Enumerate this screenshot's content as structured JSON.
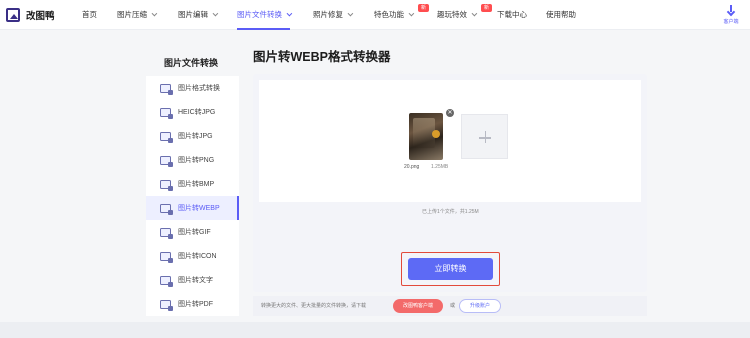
{
  "app": {
    "logo_text": "改图鸭"
  },
  "nav": {
    "items": [
      {
        "label": "首页"
      },
      {
        "label": "图片压缩"
      },
      {
        "label": "图片编辑"
      },
      {
        "label": "图片文件转换"
      },
      {
        "label": "照片修复"
      },
      {
        "label": "特色功能",
        "badge": "新"
      },
      {
        "label": "趣玩特效",
        "badge": "新"
      },
      {
        "label": "下载中心"
      },
      {
        "label": "使用帮助"
      }
    ],
    "client_label": "客户端"
  },
  "sidebar": {
    "title": "图片文件转换",
    "items": [
      {
        "label": "图片格式转换"
      },
      {
        "label": "HEIC转JPG"
      },
      {
        "label": "图片转JPG"
      },
      {
        "label": "图片转PNG"
      },
      {
        "label": "图片转BMP"
      },
      {
        "label": "图片转WEBP"
      },
      {
        "label": "图片转GIF"
      },
      {
        "label": "图片转ICON"
      },
      {
        "label": "图片转文字"
      },
      {
        "label": "图片转PDF"
      }
    ]
  },
  "main": {
    "title": "图片转WEBP格式转换器",
    "file": {
      "name": "20.png",
      "size": "1.25MB"
    },
    "upload_info": "已上传1个文件，共1.25M",
    "convert_label": "立即转换",
    "bottom": {
      "text": "转换更大的文件、更大批量的文件转换，请下载",
      "client_button": "改图鸭客户端",
      "or": "或",
      "upgrade_button": "升级账户"
    }
  },
  "colors": {
    "accent": "#5b5cf6",
    "button": "#5d6af5",
    "highlight_border": "#e24a3b",
    "badge": "#ff4d4f"
  }
}
